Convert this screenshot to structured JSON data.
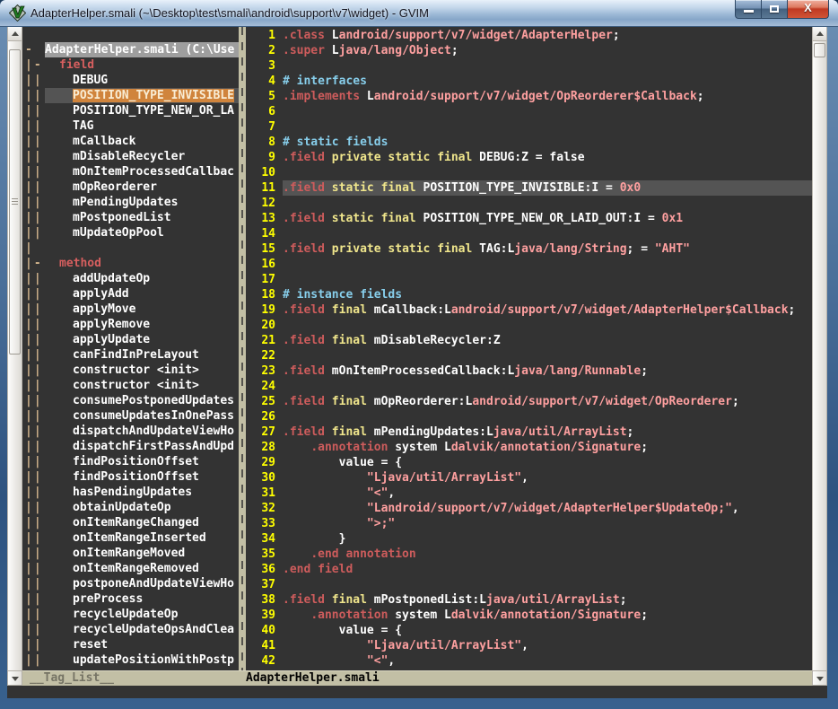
{
  "window": {
    "title": "AdapterHelper.smali (~\\Desktop\\test\\smali\\android\\support\\v7\\widget) - GVIM",
    "controls": {
      "minimize": "minimize",
      "maximize": "maximize",
      "close": "close"
    }
  },
  "colors": {
    "bg": "#333333",
    "cursorline": "#545454",
    "linenr": "#ffff00",
    "preproc": "#cd5c5c",
    "statement": "#f0e68c",
    "constant": "#ffa0a0",
    "comment": "#87ceeb",
    "normal": "#ffffff",
    "search_bg": "#d0843c",
    "search_fg": "#f8ecd4",
    "file_bg": "#9e9e9e",
    "fold": "#d2b48c",
    "status_bg": "#c2bfa5",
    "status_fg": "#000000",
    "status_nc_fg": "#767465",
    "title_red": "#d75f5f"
  },
  "taglist": {
    "status_label": "__Tag_List__",
    "rows": [
      {
        "k": "blank",
        "f": ""
      },
      {
        "k": "file",
        "f": "-",
        "t": "AdapterHelper.smali (C:\\Use"
      },
      {
        "k": "head",
        "f": "|-",
        "t": "field"
      },
      {
        "k": "tag",
        "f": "||",
        "t": "DEBUG"
      },
      {
        "k": "sel",
        "f": "||",
        "t": "POSITION_TYPE_INVISIBLE"
      },
      {
        "k": "tag",
        "f": "||",
        "t": "POSITION_TYPE_NEW_OR_LA"
      },
      {
        "k": "tag",
        "f": "||",
        "t": "TAG"
      },
      {
        "k": "tag",
        "f": "||",
        "t": "mCallback"
      },
      {
        "k": "tag",
        "f": "||",
        "t": "mDisableRecycler"
      },
      {
        "k": "tag",
        "f": "||",
        "t": "mOnItemProcessedCallbac"
      },
      {
        "k": "tag",
        "f": "||",
        "t": "mOpReorderer"
      },
      {
        "k": "tag",
        "f": "||",
        "t": "mPendingUpdates"
      },
      {
        "k": "tag",
        "f": "||",
        "t": "mPostponedList"
      },
      {
        "k": "tag",
        "f": "||",
        "t": "mUpdateOpPool"
      },
      {
        "k": "blank",
        "f": "|"
      },
      {
        "k": "head",
        "f": "|-",
        "t": "method"
      },
      {
        "k": "tag",
        "f": "||",
        "t": "addUpdateOp"
      },
      {
        "k": "tag",
        "f": "||",
        "t": "applyAdd"
      },
      {
        "k": "tag",
        "f": "||",
        "t": "applyMove"
      },
      {
        "k": "tag",
        "f": "||",
        "t": "applyRemove"
      },
      {
        "k": "tag",
        "f": "||",
        "t": "applyUpdate"
      },
      {
        "k": "tag",
        "f": "||",
        "t": "canFindInPreLayout"
      },
      {
        "k": "tag",
        "f": "||",
        "t": "constructor <init>"
      },
      {
        "k": "tag",
        "f": "||",
        "t": "constructor <init>"
      },
      {
        "k": "tag",
        "f": "||",
        "t": "consumePostponedUpdates"
      },
      {
        "k": "tag",
        "f": "||",
        "t": "consumeUpdatesInOnePass"
      },
      {
        "k": "tag",
        "f": "||",
        "t": "dispatchAndUpdateViewHo"
      },
      {
        "k": "tag",
        "f": "||",
        "t": "dispatchFirstPassAndUpd"
      },
      {
        "k": "tag",
        "f": "||",
        "t": "findPositionOffset"
      },
      {
        "k": "tag",
        "f": "||",
        "t": "findPositionOffset"
      },
      {
        "k": "tag",
        "f": "||",
        "t": "hasPendingUpdates"
      },
      {
        "k": "tag",
        "f": "||",
        "t": "obtainUpdateOp"
      },
      {
        "k": "tag",
        "f": "||",
        "t": "onItemRangeChanged"
      },
      {
        "k": "tag",
        "f": "||",
        "t": "onItemRangeInserted"
      },
      {
        "k": "tag",
        "f": "||",
        "t": "onItemRangeMoved"
      },
      {
        "k": "tag",
        "f": "||",
        "t": "onItemRangeRemoved"
      },
      {
        "k": "tag",
        "f": "||",
        "t": "postponeAndUpdateViewHo"
      },
      {
        "k": "tag",
        "f": "||",
        "t": "preProcess"
      },
      {
        "k": "tag",
        "f": "||",
        "t": "recycleUpdateOp"
      },
      {
        "k": "tag",
        "f": "||",
        "t": "recycleUpdateOpsAndClea"
      },
      {
        "k": "tag",
        "f": "||",
        "t": "reset"
      },
      {
        "k": "tag",
        "f": "||",
        "t": "updatePositionWithPostp"
      }
    ]
  },
  "editor": {
    "status_label": "AdapterHelper.smali",
    "lines": [
      {
        "n": 1,
        "t": [
          [
            "pre",
            ".class"
          ],
          [
            "n",
            " L"
          ],
          [
            "const",
            "android/support/v7/widget/AdapterHelper"
          ],
          [
            "n",
            ";"
          ]
        ]
      },
      {
        "n": 2,
        "t": [
          [
            "pre",
            ".super"
          ],
          [
            "n",
            " L"
          ],
          [
            "const",
            "java/lang/Object"
          ],
          [
            "n",
            ";"
          ]
        ]
      },
      {
        "n": 3,
        "t": []
      },
      {
        "n": 4,
        "t": [
          [
            "com",
            "# interfaces"
          ]
        ]
      },
      {
        "n": 5,
        "t": [
          [
            "pre",
            ".implements"
          ],
          [
            "n",
            " L"
          ],
          [
            "const",
            "android/support/v7/widget/OpReorderer$Callback"
          ],
          [
            "n",
            ";"
          ]
        ]
      },
      {
        "n": 6,
        "t": []
      },
      {
        "n": 7,
        "t": []
      },
      {
        "n": 8,
        "t": [
          [
            "com",
            "# static fields"
          ]
        ]
      },
      {
        "n": 9,
        "t": [
          [
            "pre",
            ".field"
          ],
          [
            "n",
            " "
          ],
          [
            "stmt",
            "private static final"
          ],
          [
            "n",
            " DEBUG:Z = false"
          ]
        ]
      },
      {
        "n": 10,
        "t": []
      },
      {
        "n": 11,
        "cur": true,
        "t": [
          [
            "pre",
            ".field"
          ],
          [
            "n",
            " "
          ],
          [
            "stmt",
            "static final"
          ],
          [
            "n",
            " POSITION_TYPE_INVISIBLE:I = "
          ],
          [
            "const",
            "0x0"
          ]
        ]
      },
      {
        "n": 12,
        "t": []
      },
      {
        "n": 13,
        "t": [
          [
            "pre",
            ".field"
          ],
          [
            "n",
            " "
          ],
          [
            "stmt",
            "static final"
          ],
          [
            "n",
            " POSITION_TYPE_NEW_OR_LAID_OUT:I = "
          ],
          [
            "const",
            "0x1"
          ]
        ]
      },
      {
        "n": 14,
        "t": []
      },
      {
        "n": 15,
        "t": [
          [
            "pre",
            ".field"
          ],
          [
            "n",
            " "
          ],
          [
            "stmt",
            "private static final"
          ],
          [
            "n",
            " TAG:L"
          ],
          [
            "const",
            "java/lang/String"
          ],
          [
            "n",
            "; = "
          ],
          [
            "const",
            "\"AHT\""
          ]
        ]
      },
      {
        "n": 16,
        "t": []
      },
      {
        "n": 17,
        "t": []
      },
      {
        "n": 18,
        "t": [
          [
            "com",
            "# instance fields"
          ]
        ]
      },
      {
        "n": 19,
        "t": [
          [
            "pre",
            ".field"
          ],
          [
            "n",
            " "
          ],
          [
            "stmt",
            "final"
          ],
          [
            "n",
            " mCallback:L"
          ],
          [
            "const",
            "android/support/v7/widget/AdapterHelper$Callback"
          ],
          [
            "n",
            ";"
          ]
        ]
      },
      {
        "n": 20,
        "t": []
      },
      {
        "n": 21,
        "t": [
          [
            "pre",
            ".field"
          ],
          [
            "n",
            " "
          ],
          [
            "stmt",
            "final"
          ],
          [
            "n",
            " mDisableRecycler:Z"
          ]
        ]
      },
      {
        "n": 22,
        "t": []
      },
      {
        "n": 23,
        "t": [
          [
            "pre",
            ".field"
          ],
          [
            "n",
            " mOnItemProcessedCallback:L"
          ],
          [
            "const",
            "java/lang/Runnable"
          ],
          [
            "n",
            ";"
          ]
        ]
      },
      {
        "n": 24,
        "t": []
      },
      {
        "n": 25,
        "t": [
          [
            "pre",
            ".field"
          ],
          [
            "n",
            " "
          ],
          [
            "stmt",
            "final"
          ],
          [
            "n",
            " mOpReorderer:L"
          ],
          [
            "const",
            "android/support/v7/widget/OpReorderer"
          ],
          [
            "n",
            ";"
          ]
        ]
      },
      {
        "n": 26,
        "t": []
      },
      {
        "n": 27,
        "t": [
          [
            "pre",
            ".field"
          ],
          [
            "n",
            " "
          ],
          [
            "stmt",
            "final"
          ],
          [
            "n",
            " mPendingUpdates:L"
          ],
          [
            "const",
            "java/util/ArrayList"
          ],
          [
            "n",
            ";"
          ]
        ]
      },
      {
        "n": 28,
        "t": [
          [
            "n",
            "    "
          ],
          [
            "pre",
            ".annotation"
          ],
          [
            "n",
            " system L"
          ],
          [
            "const",
            "dalvik/annotation/Signature"
          ],
          [
            "n",
            ";"
          ]
        ]
      },
      {
        "n": 29,
        "t": [
          [
            "n",
            "        value = {"
          ]
        ]
      },
      {
        "n": 30,
        "t": [
          [
            "n",
            "            "
          ],
          [
            "const",
            "\"Ljava/util/ArrayList\""
          ],
          [
            "n",
            ","
          ]
        ]
      },
      {
        "n": 31,
        "t": [
          [
            "n",
            "            "
          ],
          [
            "const",
            "\"<\""
          ],
          [
            "n",
            ","
          ]
        ]
      },
      {
        "n": 32,
        "t": [
          [
            "n",
            "            "
          ],
          [
            "const",
            "\"Landroid/support/v7/widget/AdapterHelper$UpdateOp;\""
          ],
          [
            "n",
            ","
          ]
        ]
      },
      {
        "n": 33,
        "t": [
          [
            "n",
            "            "
          ],
          [
            "const",
            "\">;\""
          ]
        ]
      },
      {
        "n": 34,
        "t": [
          [
            "n",
            "        }"
          ]
        ]
      },
      {
        "n": 35,
        "t": [
          [
            "n",
            "    "
          ],
          [
            "pre",
            ".end annotation"
          ]
        ]
      },
      {
        "n": 36,
        "t": [
          [
            "pre",
            ".end field"
          ]
        ]
      },
      {
        "n": 37,
        "t": []
      },
      {
        "n": 38,
        "t": [
          [
            "pre",
            ".field"
          ],
          [
            "n",
            " "
          ],
          [
            "stmt",
            "final"
          ],
          [
            "n",
            " mPostponedList:L"
          ],
          [
            "const",
            "java/util/ArrayList"
          ],
          [
            "n",
            ";"
          ]
        ]
      },
      {
        "n": 39,
        "t": [
          [
            "n",
            "    "
          ],
          [
            "pre",
            ".annotation"
          ],
          [
            "n",
            " system L"
          ],
          [
            "const",
            "dalvik/annotation/Signature"
          ],
          [
            "n",
            ";"
          ]
        ]
      },
      {
        "n": 40,
        "t": [
          [
            "n",
            "        value = {"
          ]
        ]
      },
      {
        "n": 41,
        "t": [
          [
            "n",
            "            "
          ],
          [
            "const",
            "\"Ljava/util/ArrayList\""
          ],
          [
            "n",
            ","
          ]
        ]
      },
      {
        "n": 42,
        "t": [
          [
            "n",
            "            "
          ],
          [
            "const",
            "\"<\""
          ],
          [
            "n",
            ","
          ]
        ]
      }
    ]
  }
}
